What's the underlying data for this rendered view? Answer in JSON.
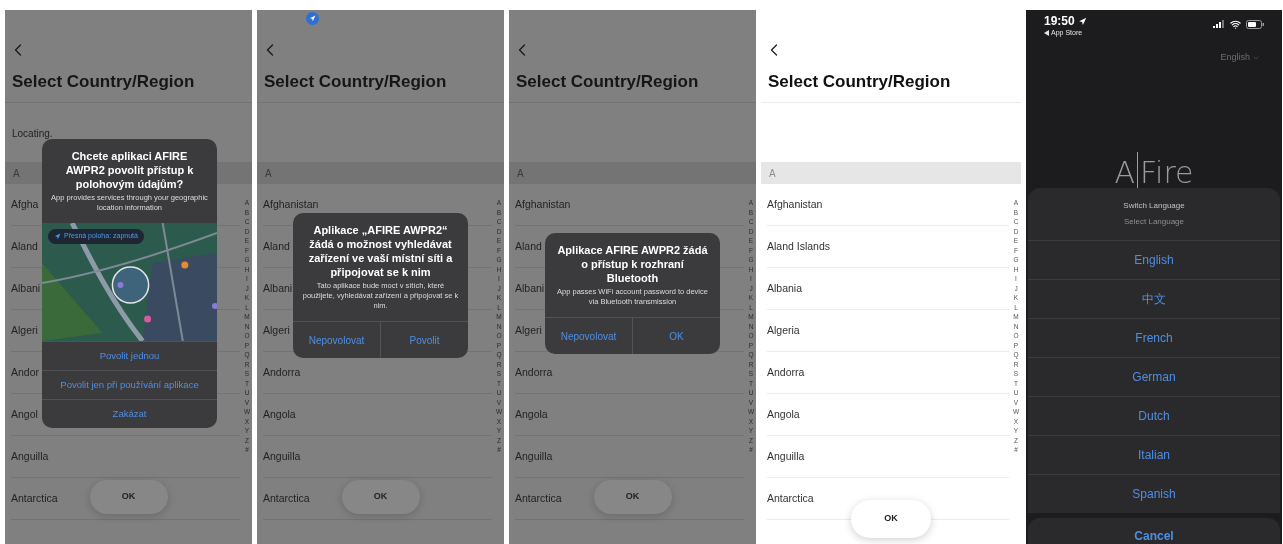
{
  "screens": [
    {
      "kind": "country_list",
      "dimmed": true,
      "location_indicator": false,
      "title": "Select Country/Region",
      "status_text": "Locating.",
      "section": "A",
      "rows": [
        "Afgha",
        "Aland",
        "Albani",
        "Algeri",
        "Andor",
        "Angol",
        "Anguilla",
        "Antarctica"
      ],
      "index": [
        "A",
        "B",
        "C",
        "D",
        "E",
        "F",
        "G",
        "H",
        "I",
        "J",
        "K",
        "L",
        "M",
        "N",
        "O",
        "P",
        "Q",
        "R",
        "S",
        "T",
        "U",
        "V",
        "W",
        "X",
        "Y",
        "Z",
        "#"
      ],
      "ok_button": "OK",
      "dialog": {
        "kind": "stacked",
        "title": "Chcete aplikaci AFIRE AWPR2 povolit přístup k polohovým údajům?",
        "message": "App provides services through your geographic location information",
        "map_badge": "Přesná poloha: zapnutá",
        "buttons": [
          "Povolit jednou",
          "Povolit jen při používání aplikace",
          "Zakázat"
        ]
      }
    },
    {
      "kind": "country_list",
      "dimmed": true,
      "location_indicator": true,
      "title": "Select Country/Region",
      "section": "A",
      "rows": [
        "Afghanistan",
        "Aland",
        "Albani",
        "Algeri",
        "Andorra",
        "Angola",
        "Anguilla",
        "Antarctica"
      ],
      "index": [
        "A",
        "B",
        "C",
        "D",
        "E",
        "F",
        "G",
        "H",
        "I",
        "J",
        "K",
        "L",
        "M",
        "N",
        "O",
        "P",
        "Q",
        "R",
        "S",
        "T",
        "U",
        "V",
        "W",
        "X",
        "Y",
        "Z",
        "#"
      ],
      "ok_button": "OK",
      "dialog": {
        "kind": "row",
        "title": "Aplikace „AFIRE AWPR2“ žádá o možnost vyhledávat zařízení ve vaší místní síti a připojovat se k nim",
        "message": "Tato aplikace bude moct v sítích, které použijete, vyhledávat zařízení a připojovat se k nim.",
        "buttons": [
          "Nepovolovat",
          "Povolit"
        ]
      }
    },
    {
      "kind": "country_list",
      "dimmed": true,
      "location_indicator": false,
      "title": "Select Country/Region",
      "section": "A",
      "rows": [
        "Afghanistan",
        "Aland",
        "Albani",
        "Algeri",
        "Andorra",
        "Angola",
        "Anguilla",
        "Antarctica"
      ],
      "index": [
        "A",
        "B",
        "C",
        "D",
        "E",
        "F",
        "G",
        "H",
        "I",
        "J",
        "K",
        "L",
        "M",
        "N",
        "O",
        "P",
        "Q",
        "R",
        "S",
        "T",
        "U",
        "V",
        "W",
        "X",
        "Y",
        "Z",
        "#"
      ],
      "ok_button": "OK",
      "dialog": {
        "kind": "row",
        "title": "Aplikace AFIRE AWPR2 žádá o přístup k rozhraní Bluetooth",
        "message": "App passes WiFi account password to device via Bluetooth transmission",
        "buttons": [
          "Nepovolovat",
          "OK"
        ]
      }
    },
    {
      "kind": "country_list",
      "dimmed": false,
      "location_indicator": false,
      "title": "Select Country/Region",
      "section": "A",
      "rows": [
        "Afghanistan",
        "Aland Islands",
        "Albania",
        "Algeria",
        "Andorra",
        "Angola",
        "Anguilla",
        "Antarctica"
      ],
      "index": [
        "A",
        "B",
        "C",
        "D",
        "E",
        "F",
        "G",
        "H",
        "I",
        "J",
        "K",
        "L",
        "M",
        "N",
        "O",
        "P",
        "Q",
        "R",
        "S",
        "T",
        "U",
        "V",
        "W",
        "X",
        "Y",
        "Z",
        "#"
      ],
      "ok_button": "OK"
    },
    {
      "kind": "language_sheet",
      "status": {
        "time": "19:50",
        "back_app": "App Store"
      },
      "language": "English",
      "logo": {
        "left": "A",
        "right": "Fire"
      },
      "sheet": {
        "title": "Switch Language",
        "subtitle": "Select Language",
        "options": [
          "English",
          "中文",
          "French",
          "German",
          "Dutch",
          "Italian",
          "Spanish"
        ],
        "cancel": "Cancel"
      }
    }
  ]
}
